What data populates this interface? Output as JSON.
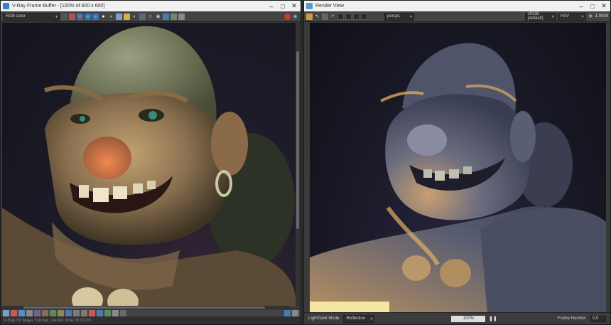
{
  "vfb": {
    "title": "V-Ray Frame Buffer - [100% of 600 x 600]",
    "channel_select": "RGB color",
    "status_text": "V-Ray for Maya Tutorial | render time 00:00:00",
    "accent_red": "#c83a2a",
    "accent_blue": "#3b6fb0"
  },
  "rv": {
    "title": "Render View",
    "camera_select": "persp1",
    "colorspace_select": "sRGB (default)",
    "mode_select": "HSV",
    "exposure_value": "1.0000",
    "lightpaint_label": "LightPaint Mode",
    "lightpaint_select": "Reflection",
    "progress_value": "100%",
    "frame_label": "Frame Number",
    "frame_value": "0.0"
  },
  "window_buttons": {
    "minimize": "–",
    "maximize": "□",
    "close": "✕"
  }
}
